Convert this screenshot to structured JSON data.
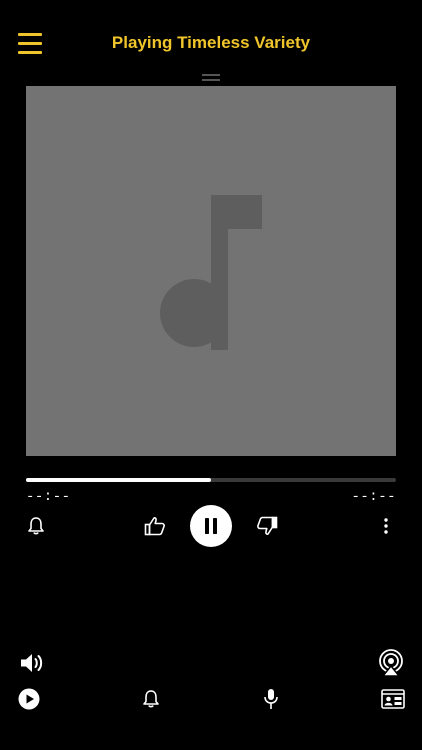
{
  "header": {
    "menu_icon": "hamburger-menu-icon",
    "title": "Playing Timeless Variety",
    "accent_color": "#f0c52b"
  },
  "artwork": {
    "placeholder_icon": "music-note-icon",
    "background_color": "#737373"
  },
  "progress": {
    "fraction": 0.5,
    "elapsed": "--:--",
    "remaining": "--:--"
  },
  "controls": {
    "alert_icon": "bell-icon",
    "like_icon": "thumbs-up-icon",
    "play_state_icon": "pause-icon",
    "dislike_icon": "thumbs-down-icon",
    "more_icon": "more-vertical-icon"
  },
  "bottom_bar": {
    "volume_icon": "speaker-volume-icon",
    "airplay_icon": "airplay-icon",
    "play_icon": "play-circle-icon",
    "alarm_icon": "bell-icon",
    "microphone_icon": "microphone-icon",
    "card_icon": "contact-card-icon"
  }
}
